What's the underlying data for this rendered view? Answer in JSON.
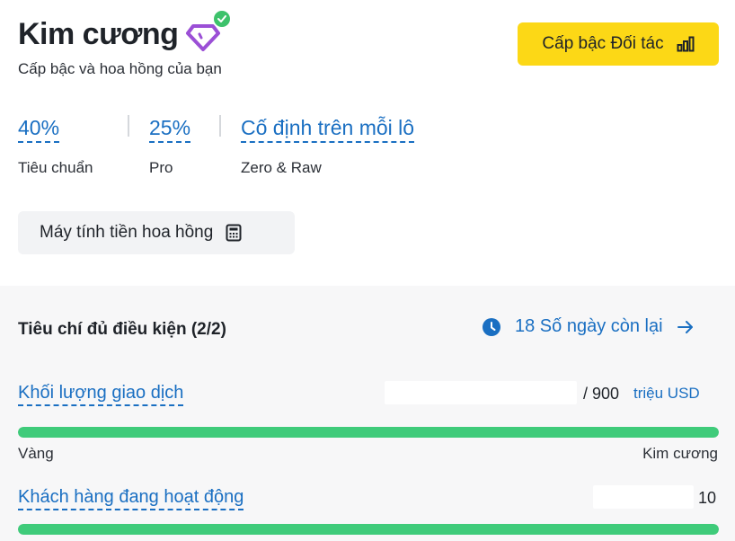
{
  "header": {
    "title": "Kim cương",
    "subtitle": "Cấp bậc và hoa hồng của bạn",
    "partner_button": "Cấp bậc Đối tác"
  },
  "rates": [
    {
      "value": "40%",
      "label": "Tiêu chuẩn"
    },
    {
      "value": "25%",
      "label": "Pro"
    },
    {
      "value": "Cố định trên mỗi lô",
      "label": "Zero & Raw"
    }
  ],
  "calculator_button": "Máy tính tiền hoa hồng",
  "criteria": {
    "title": "Tiêu chí đủ điều kiện (2/2)",
    "days_left": "18 Số ngày còn lại",
    "metrics": [
      {
        "label": "Khối lượng giao dịch",
        "target": "/ 900",
        "unit": "triệu USD",
        "progress": 1.0,
        "range_start": "Vàng",
        "range_end": "Kim cương"
      },
      {
        "label": "Khách hàng đang hoạt động",
        "target": "10",
        "progress": 1.0
      }
    ]
  },
  "colors": {
    "accent": "#1a6fc2",
    "brand_yellow": "#fcd816",
    "progress_green": "#3fcb7a",
    "gem_purple": "#9b4fd6",
    "check_green": "#3dc26b"
  },
  "icons": {
    "tier": "diamond-icon",
    "verified": "check-badge-icon",
    "partner": "bar-chart-icon",
    "calculator": "calculator-icon",
    "clock": "clock-icon",
    "arrow": "arrow-right-icon"
  }
}
